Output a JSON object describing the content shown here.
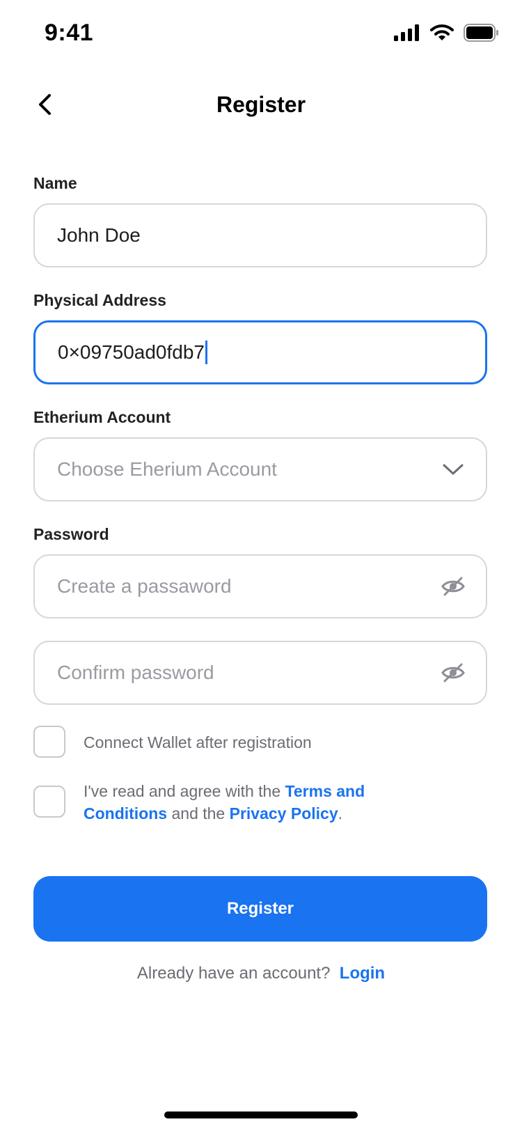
{
  "status_bar": {
    "time": "9:41"
  },
  "header": {
    "title": "Register"
  },
  "form": {
    "name": {
      "label": "Name",
      "value": "John Doe"
    },
    "address": {
      "label": "Physical Address",
      "value": "0×09750ad0fdb7"
    },
    "ethereum": {
      "label": "Etherium Account",
      "placeholder": "Choose Eherium Account"
    },
    "password": {
      "label": "Password",
      "placeholder": "Create a passaword"
    },
    "confirm": {
      "placeholder": "Confirm password"
    },
    "connect_wallet": {
      "text": "Connect Wallet after registration",
      "checked": false
    },
    "agreement": {
      "text_before": "I've read and agree with the ",
      "terms_link": "Terms and Conditions",
      "text_middle": " and the ",
      "privacy_link": "Privacy Policy",
      "text_after": ".",
      "checked": false
    },
    "submit_label": "Register"
  },
  "footer": {
    "prompt": "Already have an account?",
    "login_link": "Login"
  },
  "colors": {
    "accent": "#1a73f0",
    "placeholder": "#9a9aa2",
    "border": "#d6d6dc"
  },
  "icons": [
    "signal-icon",
    "wifi-icon",
    "battery-icon",
    "back-chevron-icon",
    "chevron-down-icon",
    "eye-off-icon"
  ]
}
